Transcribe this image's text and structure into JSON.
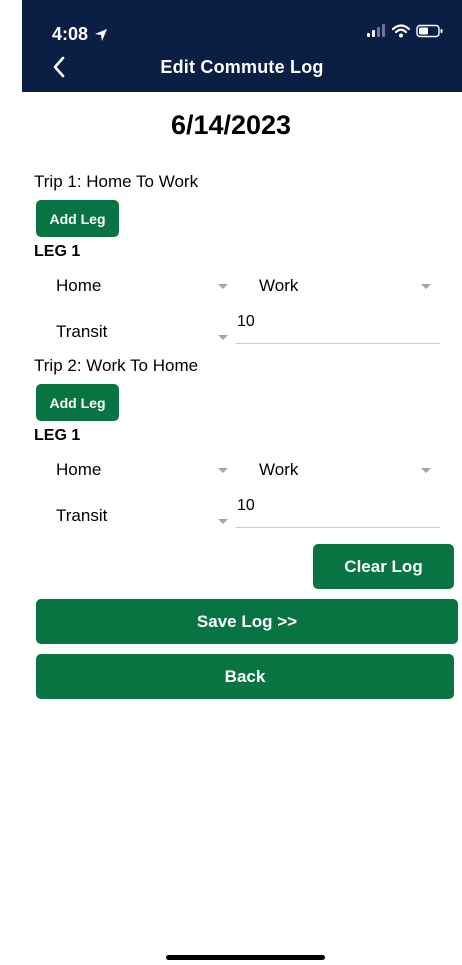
{
  "status_bar": {
    "time": "4:08",
    "icons": [
      "location-arrow-icon",
      "cellular-signal-icon",
      "wifi-icon",
      "battery-icon"
    ]
  },
  "header": {
    "title": "Edit Commute Log",
    "background_color": "#0b1f45"
  },
  "date": "6/14/2023",
  "trips": [
    {
      "label": "Trip 1: Home To Work",
      "add_leg_label": "Add Leg",
      "legs": [
        {
          "label": "LEG 1",
          "from": "Home",
          "to": "Work",
          "mode": "Transit",
          "value": "10"
        }
      ]
    },
    {
      "label": "Trip 2: Work To Home",
      "add_leg_label": "Add Leg",
      "legs": [
        {
          "label": "LEG 1",
          "from": "Home",
          "to": "Work",
          "mode": "Transit",
          "value": "10"
        }
      ]
    }
  ],
  "actions": {
    "clear_label": "Clear Log",
    "save_label": "Save Log >>",
    "back_label": "Back"
  },
  "colors": {
    "accent": "#087442",
    "header": "#0b1f45"
  }
}
